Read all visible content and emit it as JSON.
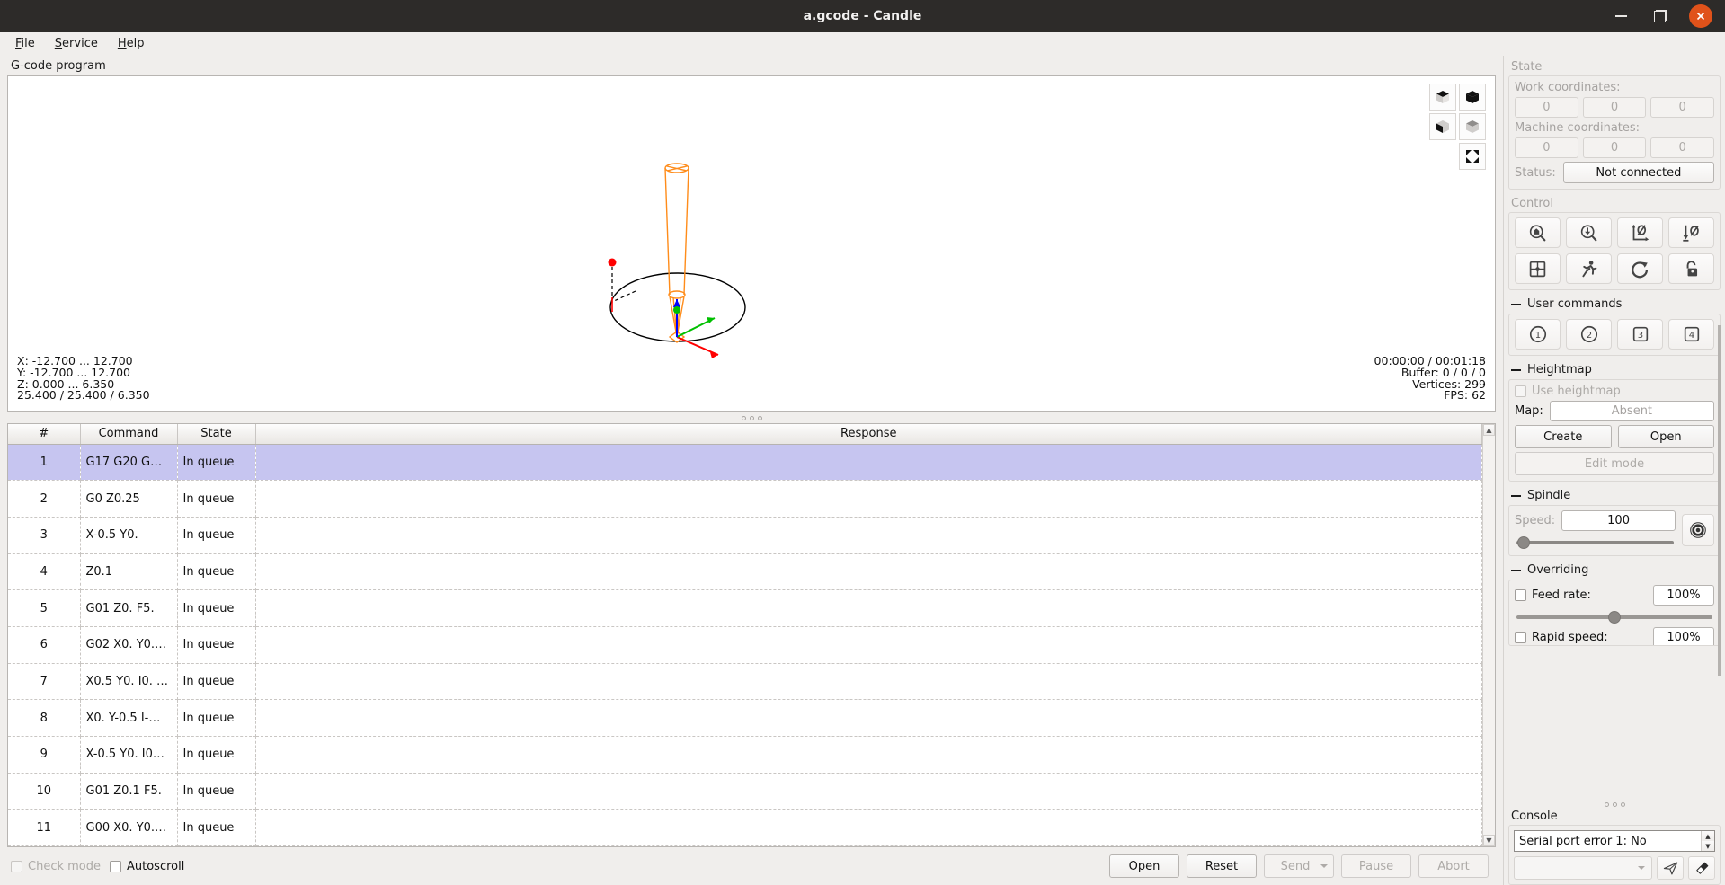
{
  "window": {
    "title": "a.gcode - Candle",
    "buttons": {
      "minimize": "minimize-button",
      "maximize": "maximize-button",
      "close": "close-button"
    }
  },
  "menubar": {
    "items": [
      "File",
      "Service",
      "Help"
    ]
  },
  "left": {
    "group_title": "G-code program",
    "viewport": {
      "toolbar": [
        "iso-view-button",
        "top-view-button",
        "front-view-button",
        "left-view-button",
        "fit-button"
      ],
      "stats_left": "X: -12.700 ... 12.700\nY: -12.700 ... 12.700\nZ: 0.000 ... 6.350\n25.400 / 25.400 / 6.350",
      "stats_right": "00:00:00 / 00:01:18\nBuffer: 0 / 0 / 0\nVertices: 299\nFPS: 62"
    },
    "table": {
      "headers": [
        "#",
        "Command",
        "State",
        "Response"
      ],
      "rows": [
        {
          "n": "1",
          "command": "G17 G20 G…",
          "state": "In queue",
          "response": "",
          "selected": true
        },
        {
          "n": "2",
          "command": "G0 Z0.25",
          "state": "In queue",
          "response": "",
          "selected": false
        },
        {
          "n": "3",
          "command": "X-0.5 Y0.",
          "state": "In queue",
          "response": "",
          "selected": false
        },
        {
          "n": "4",
          "command": "Z0.1",
          "state": "In queue",
          "response": "",
          "selected": false
        },
        {
          "n": "5",
          "command": "G01 Z0. F5.",
          "state": "In queue",
          "response": "",
          "selected": false
        },
        {
          "n": "6",
          "command": "G02 X0. Y0.…",
          "state": "In queue",
          "response": "",
          "selected": false
        },
        {
          "n": "7",
          "command": "X0.5 Y0. I0. …",
          "state": "In queue",
          "response": "",
          "selected": false
        },
        {
          "n": "8",
          "command": "X0. Y-0.5 I-…",
          "state": "In queue",
          "response": "",
          "selected": false
        },
        {
          "n": "9",
          "command": "X-0.5 Y0. I0…",
          "state": "In queue",
          "response": "",
          "selected": false
        },
        {
          "n": "10",
          "command": "G01 Z0.1 F5.",
          "state": "In queue",
          "response": "",
          "selected": false
        },
        {
          "n": "11",
          "command": "G00 X0. Y0.…",
          "state": "In queue",
          "response": "",
          "selected": false
        }
      ]
    },
    "bottombar": {
      "check_mode": "Check mode",
      "autoscroll": "Autoscroll",
      "open": "Open",
      "reset": "Reset",
      "send": "Send",
      "pause": "Pause",
      "abort": "Abort"
    }
  },
  "right": {
    "state": {
      "title": "State",
      "work_label": "Work coordinates:",
      "work_values": [
        "0",
        "0",
        "0"
      ],
      "machine_label": "Machine coordinates:",
      "machine_values": [
        "0",
        "0",
        "0"
      ],
      "status_label": "Status:",
      "status_value": "Not connected"
    },
    "control": {
      "title": "Control",
      "buttons": [
        "home-button",
        "safe-position-button",
        "zero-xy-button",
        "zero-z-button",
        "restore-origin-button",
        "run-button",
        "reset-button",
        "unlock-button"
      ]
    },
    "user_commands": {
      "title": "User commands",
      "buttons": [
        "1",
        "2",
        "3",
        "4"
      ]
    },
    "heightmap": {
      "title": "Heightmap",
      "use_label": "Use heightmap",
      "map_label": "Map:",
      "map_value": "Absent",
      "create": "Create",
      "open": "Open",
      "edit_mode": "Edit mode"
    },
    "spindle": {
      "title": "Spindle",
      "speed_label": "Speed:",
      "speed_value": "100",
      "slider_percent": 2,
      "toggle": "spindle-toggle-button"
    },
    "overriding": {
      "title": "Overriding",
      "feed_label": "Feed rate:",
      "feed_value": "100%",
      "feed_slider_percent": 50,
      "rapid_label": "Rapid speed:",
      "rapid_value": "100%"
    },
    "console": {
      "title": "Console",
      "last_line": "Serial port error 1: No",
      "input_placeholder": "",
      "send_button": "send-command-button",
      "clear_button": "clear-console-button"
    }
  },
  "colors": {
    "titlebar_bg": "#2d2b29",
    "close_red": "#e0521a",
    "selection": "#c6c5f0",
    "tool_orange": "#ff8c1a",
    "axis_x": "#ff0000",
    "axis_y": "#00c000",
    "axis_z": "#0000ff"
  }
}
